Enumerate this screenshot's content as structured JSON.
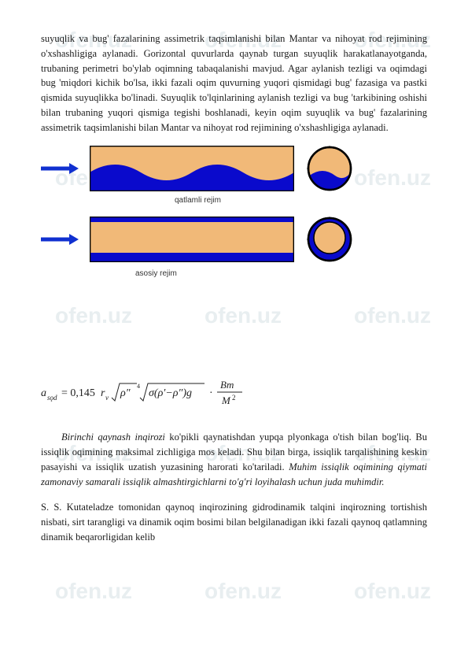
{
  "watermark_text": "ofen.uz",
  "paragraphs": {
    "p1": "suyuqlik va bug' fazalarining assimetrik taqsimlanishi bilan Mantar va nihoyat rod rejimining o'xshashligiga aylanadi. Gorizontal quvurlarda qaynab turgan suyuqlik harakatlanayotganda, trubaning perimetri bo'ylab oqimning tabaqalanishi mavjud. Agar aylanish tezligi va oqimdagi bug 'miqdori kichik bo'lsa, ikki fazali oqim quvurning yuqori qismidagi bug' fazasiga va pastki qismida suyuqlikka bo'linadi. Suyuqlik to'lqinlarining aylanish tezligi va bug 'tarkibining oshishi bilan trubaning yuqori qismiga tegishi boshlanadi, keyin oqim suyuqlik va bug' fazalarining assimetrik taqsimlanishi bilan Mantar va nihoyat rod rejimining o'xshashligiga aylanadi."
  },
  "diagram": {
    "caption_top": "qatlamli rejim",
    "caption_bottom": "asosiy rejim"
  },
  "formula_text": "a_{sǫd} = 0,145 r_{v} ∜(ρ″) ∜(σ(ρ′−ρ″)) g · Bm / M²",
  "paragraph2": {
    "lead_italic": "Birinchi qaynash inqirozi",
    "lead_rest": " ko'pikli qaynatishdan yupqa plyonkaga o'tish bilan bog'liq. Bu issiqlik oqimining maksimal zichligiga mos keladi. Shu bilan birga, issiqlik tarqalishining keskin pasayishi va issiqlik uzatish yuzasining harorati ko'tariladi. ",
    "mid_italic": "Muhim issiqlik oqimining qiymati zamonaviy samarali issiqlik almashtirgichlarni to'g'ri loyihalash uchun juda muhimdir.",
    "tail": "S. S. Kutateladze tomonidan qaynoq inqirozining gidrodinamik talqini inqirozning tortishish nisbati, sirt tarangligi va dinamik oqim bosimi bilan belgilanadigan ikki fazali qaynoq qatlamning dinamik beqarorligidan kelib"
  }
}
